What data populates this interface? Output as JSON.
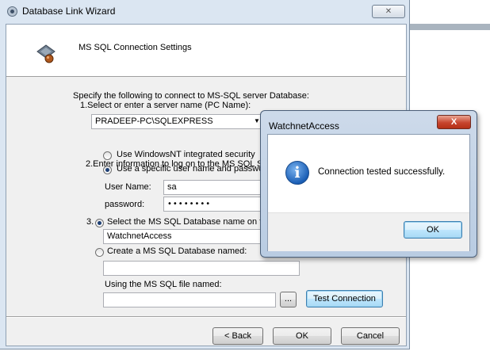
{
  "wizard": {
    "title": "Database Link Wizard",
    "close_glyph": "✕",
    "header": "MS SQL Connection Settings",
    "instruction": "Specify the following to connect to MS-SQL server Database:",
    "step1_label": "1.Select or enter a server name (PC Name):",
    "server_value": "PRADEEP-PC\\SQLEXPRESS",
    "combo_arrow": "▼",
    "step2_label": "2.Enter information to log on to the MS SQL Serv",
    "auth_windows": "Use WindowsNT integrated security",
    "auth_specific": "Use a specific user name and password",
    "username_label": "User Name:",
    "username_value": "sa",
    "password_label": "password:",
    "password_value": "••••••••",
    "step3_number": "3.",
    "select_db_label": "Select the MS SQL Database name on the",
    "db_value": "WatchnetAccess",
    "create_db_label": "Create a MS SQL Database named:",
    "create_db_value": "",
    "file_label": "Using the MS SQL file named:",
    "file_value": "",
    "browse_label": "...",
    "test_label": "Test Connection",
    "back_label": "< Back",
    "ok_label": "OK",
    "cancel_label": "Cancel",
    "selected_auth": "specific",
    "selected_db_option": "select"
  },
  "message_box": {
    "title": "WatchnetAccess",
    "close_glyph": "X",
    "icon": "info-icon",
    "icon_glyph": "i",
    "text": "Connection tested successfully.",
    "ok_label": "OK"
  }
}
